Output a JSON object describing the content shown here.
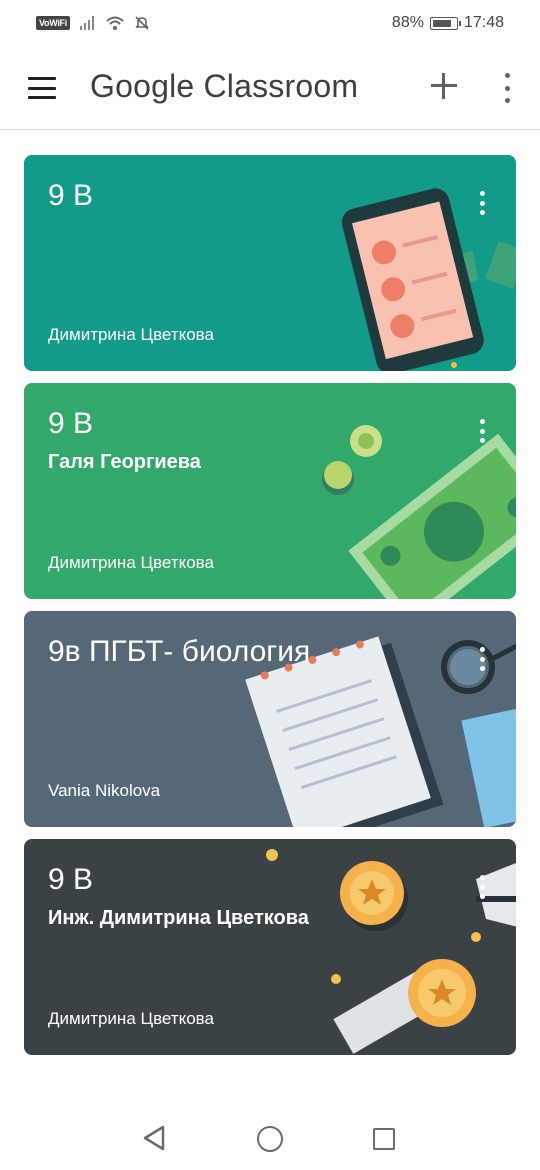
{
  "status_bar": {
    "network_badge": "VoWiFi",
    "battery_percent": "88%",
    "battery_level": 0.88,
    "time": "17:48"
  },
  "app_bar": {
    "title": "Google Classroom",
    "icons": [
      "menu-icon",
      "plus-icon",
      "more-vert-icon"
    ]
  },
  "classes": [
    {
      "title": "9 В",
      "subtitle": "",
      "teacher": "Димитрина Цветкова",
      "color": "#129b89",
      "theme": "phone"
    },
    {
      "title": "9 В",
      "subtitle": "Галя Георгиева",
      "teacher": "Димитрина Цветкова",
      "color": "#32a96b",
      "theme": "money"
    },
    {
      "title": "9в ПГБТ- биология",
      "subtitle": "",
      "teacher": "Vania Nikolova",
      "color": "#566877",
      "theme": "notebook"
    },
    {
      "title": "9 В",
      "subtitle": "Инж. Димитрина Цветкова",
      "teacher": "Димитрина Цветкова",
      "color": "#3b4245",
      "theme": "medals"
    }
  ],
  "nav_bar": {
    "icons": [
      "back-icon",
      "home-icon",
      "recent-apps-icon"
    ]
  }
}
